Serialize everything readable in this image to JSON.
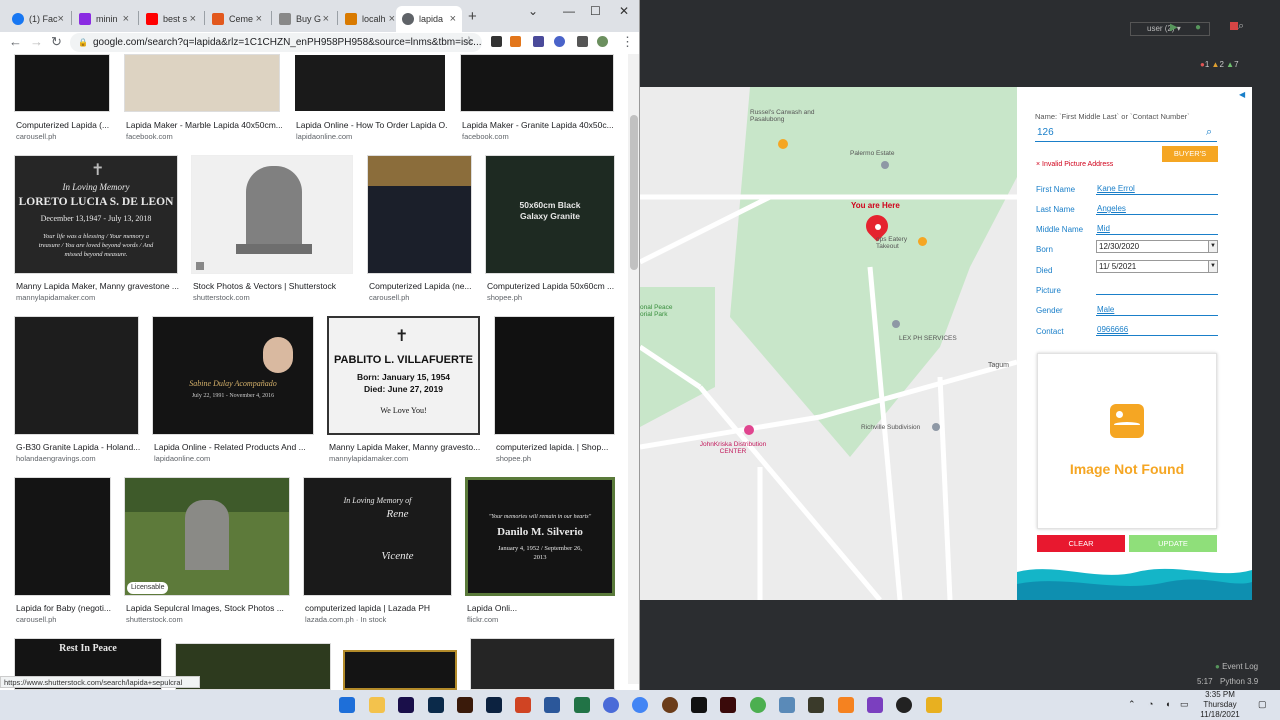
{
  "browser": {
    "tabs": [
      {
        "label": "(1) Fac",
        "color": "#1877f2"
      },
      {
        "label": "minin",
        "color": "#8a2be2"
      },
      {
        "label": "best s",
        "color": "#ff0000"
      },
      {
        "label": "Ceme",
        "color": "#e2581d"
      },
      {
        "label": "Buy G",
        "color": "#888888"
      },
      {
        "label": "localh",
        "color": "#d97a00"
      },
      {
        "label": "lapida",
        "color": "#5f6368"
      }
    ],
    "url": "google.com/search?q=lapida&rlz=1C1CHZN_enPH958PH958&source=lnms&tbm=isc...",
    "status_url": "https://www.shutterstock.com/search/lapida+sepulcral",
    "results": [
      {
        "title": "Computerized Lapida (...",
        "source": "carousell.ph"
      },
      {
        "title": "Lapida Maker - Marble Lapida 40x50cm...",
        "source": "facebook.com"
      },
      {
        "title": "Lapida Online - How To Order Lapida O...",
        "source": "lapidaonline.com"
      },
      {
        "title": "Lapida Maker - Granite Lapida 40x50c...",
        "source": "facebook.com"
      },
      {
        "title": "Manny Lapida Maker, Manny gravestone ...",
        "source": "mannylapidamaker.com"
      },
      {
        "title": "Stock Photos & Vectors | Shutterstock",
        "source": "shutterstock.com"
      },
      {
        "title": "Computerized Lapida (ne...",
        "source": "carousell.ph"
      },
      {
        "title": "Computerized Lapida 50x60cm ...",
        "source": "shopee.ph"
      },
      {
        "title": "G-B30 Granite Lapida - Holand...",
        "source": "holandaengravings.com"
      },
      {
        "title": "Lapida Online - Related Products And ...",
        "source": "lapidaonline.com"
      },
      {
        "title": "Manny Lapida Maker, Manny gravesto...",
        "source": "mannylapidamaker.com"
      },
      {
        "title": "computerized lapida. | Shop...",
        "source": "shopee.ph"
      },
      {
        "title": "Lapida for Baby (negoti...",
        "source": "carousell.ph"
      },
      {
        "title": "Lapida Sepulcral Images, Stock Photos ...",
        "source": "shutterstock.com"
      },
      {
        "title": "computerized lapida | Lazada PH",
        "source": "lazada.com.ph · In stock"
      },
      {
        "title": "Lapida Onli...",
        "source": "flickr.com"
      }
    ],
    "slab_texts": {
      "row1_left": "In Loving Memory",
      "row1_name": "LORETO LUCIA S. DE LEON",
      "row1_dates": "December 13,1947 - July 13, 2018",
      "row1_poem": "Your life was a blessing / Your memory a treasure / You are loved beyond words / And missed beyond measure.",
      "granite_title": "50x60cm Black Galaxy Granite",
      "pablito_name": "PABLITO L. VILLAFUERTE",
      "pablito_born": "Born: January 15, 1954",
      "pablito_died": "Died: June 27, 2019",
      "pablito_msg": "We Love You!",
      "rene_heading": "In Loving Memory of",
      "rene_name": "Rene",
      "vicente_name": "Vicente",
      "danilo_quote": "\"Your memories will remain in our hearts\"",
      "danilo_name": "Danilo M. Silverio",
      "danilo_dates": "January 4, 1952 / September 26, 2013",
      "rest_in_peace": "Rest In Peace",
      "licensable": "Licensable",
      "sabine": "Sabine Dulay Acompañado",
      "sabine_dates": "July 22, 1991 - November 4, 2016"
    }
  },
  "ide": {
    "user_label": "user (2)",
    "problems": {
      "errors": "1",
      "warnings": "2",
      "weak": "7"
    },
    "event_log": "Event Log",
    "status_pos": "5:17",
    "status_python": "Python 3.9"
  },
  "map": {
    "labels": [
      {
        "text": "Russel's Carwash and Pasalubong"
      },
      {
        "text": "Palermo Estate"
      },
      {
        "text": "You are Here"
      },
      {
        "text": "ops Eatery Takeout"
      },
      {
        "text": "LEX PH SERVICES"
      },
      {
        "text": "Tagum"
      },
      {
        "text": "Richville Subdivision"
      },
      {
        "text": "JohnKriska Distribution CENTER"
      },
      {
        "text": "onal Peace orial Park"
      }
    ]
  },
  "form": {
    "search_label": "Name: `First Middle Last` or `Contact Number`",
    "search_value": "126",
    "buyers_button": "BUYER'S",
    "error_text": "× Invalid Picture Address",
    "fields": [
      {
        "label": "First Name",
        "value": "Kane Errol"
      },
      {
        "label": "Last Name",
        "value": "Angeles"
      },
      {
        "label": "Middle Name",
        "value": "Mid"
      },
      {
        "label": "Born",
        "value": "12/30/2020"
      },
      {
        "label": "Died",
        "value": "11/ 5/2021"
      },
      {
        "label": "Picture",
        "value": ""
      },
      {
        "label": "Gender",
        "value": "Male"
      },
      {
        "label": "Contact",
        "value": "0966666"
      }
    ],
    "image_placeholder": "Image Not Found",
    "clear_button": "CLEAR",
    "update_button": "UPDATE",
    "accent": "#f5a623",
    "clear_color": "#e8182f",
    "update_color": "#8fdf7a"
  },
  "taskbar": {
    "time": "3:35 PM",
    "day": "Thursday",
    "date": "11/18/2021"
  }
}
